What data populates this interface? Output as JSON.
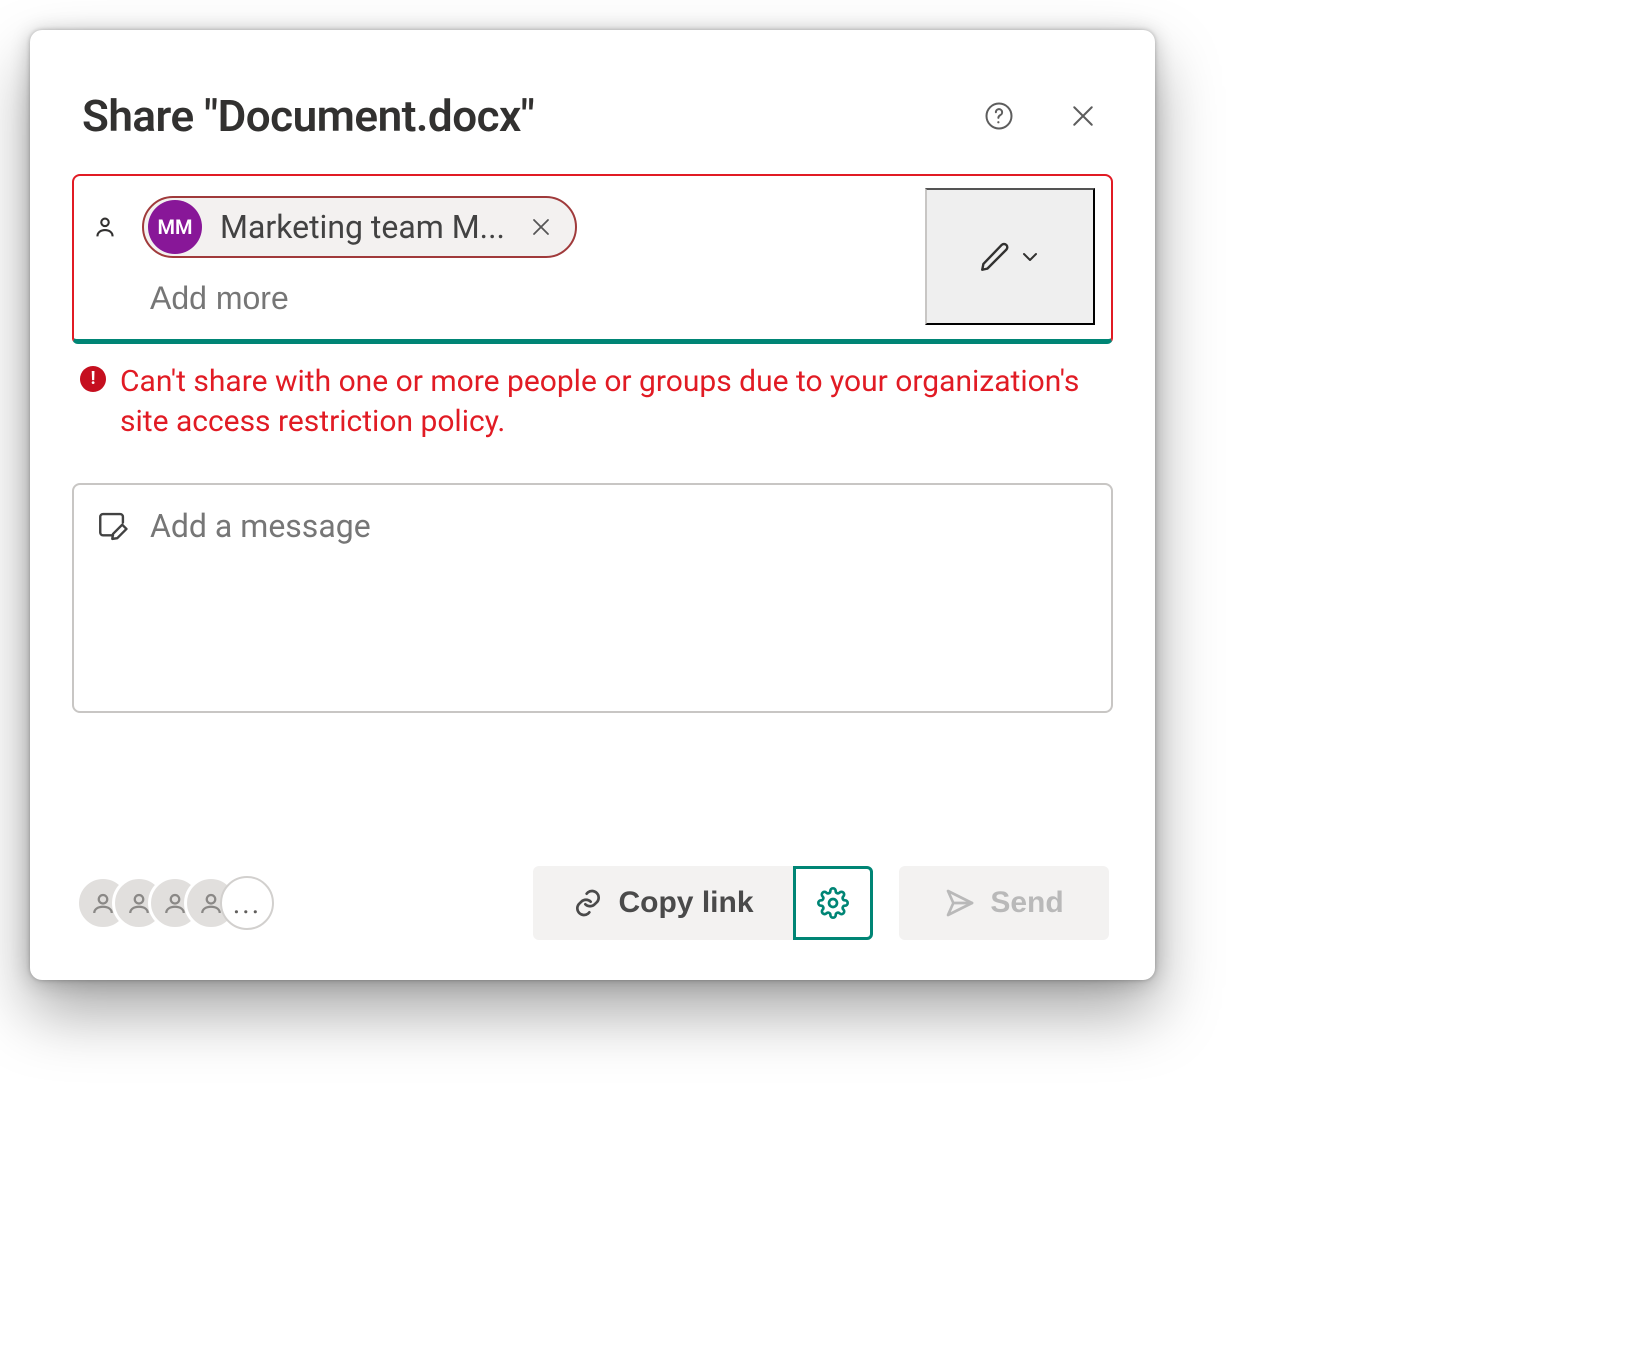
{
  "dialog": {
    "title": "Share \"Document.docx\""
  },
  "picker": {
    "chip": {
      "initials": "MM",
      "label": "Marketing team M..."
    },
    "input_placeholder": "Add more"
  },
  "error": {
    "message": "Can't share with one or more people or groups due to your organization's site access restriction policy."
  },
  "message_box": {
    "placeholder": "Add a message"
  },
  "footer": {
    "copy_label": "Copy link",
    "send_label": "Send",
    "facepile_more": "..."
  },
  "colors": {
    "accent_teal": "#008575",
    "error_red": "#e11b24",
    "avatar_purple": "#881798"
  }
}
